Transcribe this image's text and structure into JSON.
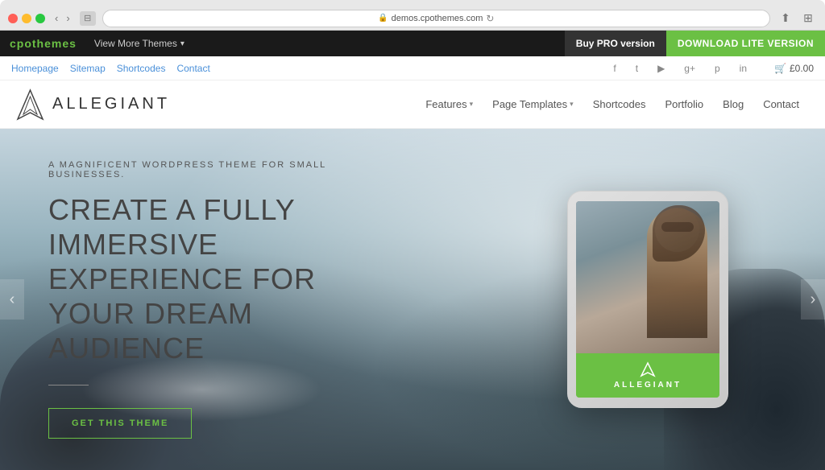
{
  "browser": {
    "url": "demos.cpothemes.com",
    "tl_red": "close",
    "tl_yellow": "minimize",
    "tl_green": "maximize"
  },
  "admin_bar": {
    "logo": "cpothemes",
    "view_more": "View More Themes",
    "buy_pro": "Buy PRO version",
    "download_lite": "DOWNLOAD LITE VERSION"
  },
  "secondary_nav": {
    "homepage": "Homepage",
    "sitemap": "Sitemap",
    "shortcodes": "Shortcodes",
    "contact": "Contact",
    "cart": "£0.00"
  },
  "main_nav": {
    "logo_text": "ALLEGIANT",
    "menu": [
      {
        "label": "Features",
        "has_dropdown": true
      },
      {
        "label": "Page Templates",
        "has_dropdown": true
      },
      {
        "label": "Shortcodes",
        "has_dropdown": false
      },
      {
        "label": "Portfolio",
        "has_dropdown": false
      },
      {
        "label": "Blog",
        "has_dropdown": false
      },
      {
        "label": "Contact",
        "has_dropdown": false
      }
    ]
  },
  "hero": {
    "subtitle": "A MAGNIFICENT WORDPRESS THEME FOR SMALL BUSINESSES.",
    "title": "CREATE A FULLY IMMERSIVE EXPERIENCE FOR YOUR DREAM AUDIENCE",
    "cta_label": "GET THIS THEME"
  },
  "tablet": {
    "theme_name": "ALLEGIANT"
  },
  "social": {
    "facebook": "f",
    "twitter": "t",
    "youtube": "▶",
    "google": "g+",
    "pinterest": "p",
    "linkedin": "in"
  }
}
